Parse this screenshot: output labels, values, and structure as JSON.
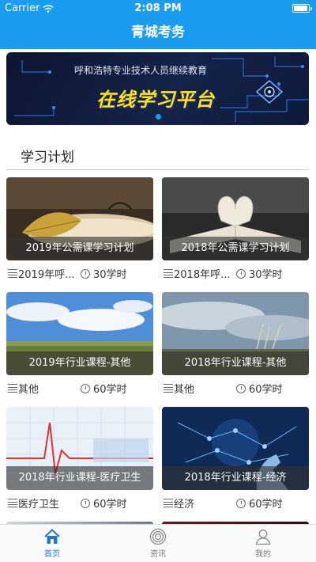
{
  "status": {
    "carrier": "Carrier",
    "time": "2:08 PM"
  },
  "nav": {
    "title": "青城考务"
  },
  "banner": {
    "subtitle": "呼和浩特专业技术人员继续教育",
    "title": "在线学习平台",
    "page_count": 1,
    "active_page": 0
  },
  "section": {
    "title": "学习计划"
  },
  "plans": [
    {
      "caption": "2019年公需课学习计划",
      "category": "2019年呼...",
      "hours": "30学时",
      "image": "autumn-leaf-on-book"
    },
    {
      "caption": "2018年公需课学习计划",
      "category": "2018年呼...",
      "hours": "30学时",
      "image": "open-book-heart-pages"
    },
    {
      "caption": "2019年行业课程-其他",
      "category": "其他",
      "hours": "60学时",
      "image": "blue-sky-grassland"
    },
    {
      "caption": "2018年行业课程-其他",
      "category": "其他",
      "hours": "60学时",
      "image": "cloudy-sky-field"
    },
    {
      "caption": "2018年行业课程-医疗卫生",
      "category": "医疗卫生",
      "hours": "60学时",
      "image": "heartbeat-ecg-line"
    },
    {
      "caption": "2018年行业课程-经济",
      "category": "经济",
      "hours": "60学时",
      "image": "digital-network-hand"
    }
  ],
  "tabs": [
    {
      "label": "首页",
      "icon": "home-icon",
      "active": true
    },
    {
      "label": "资讯",
      "icon": "news-icon",
      "active": false
    },
    {
      "label": "我的",
      "icon": "profile-icon",
      "active": false
    }
  ],
  "colors": {
    "accent": "#1a9cf0",
    "tab_active": "#1a7ad6",
    "banner_title": "#ffe21a"
  }
}
